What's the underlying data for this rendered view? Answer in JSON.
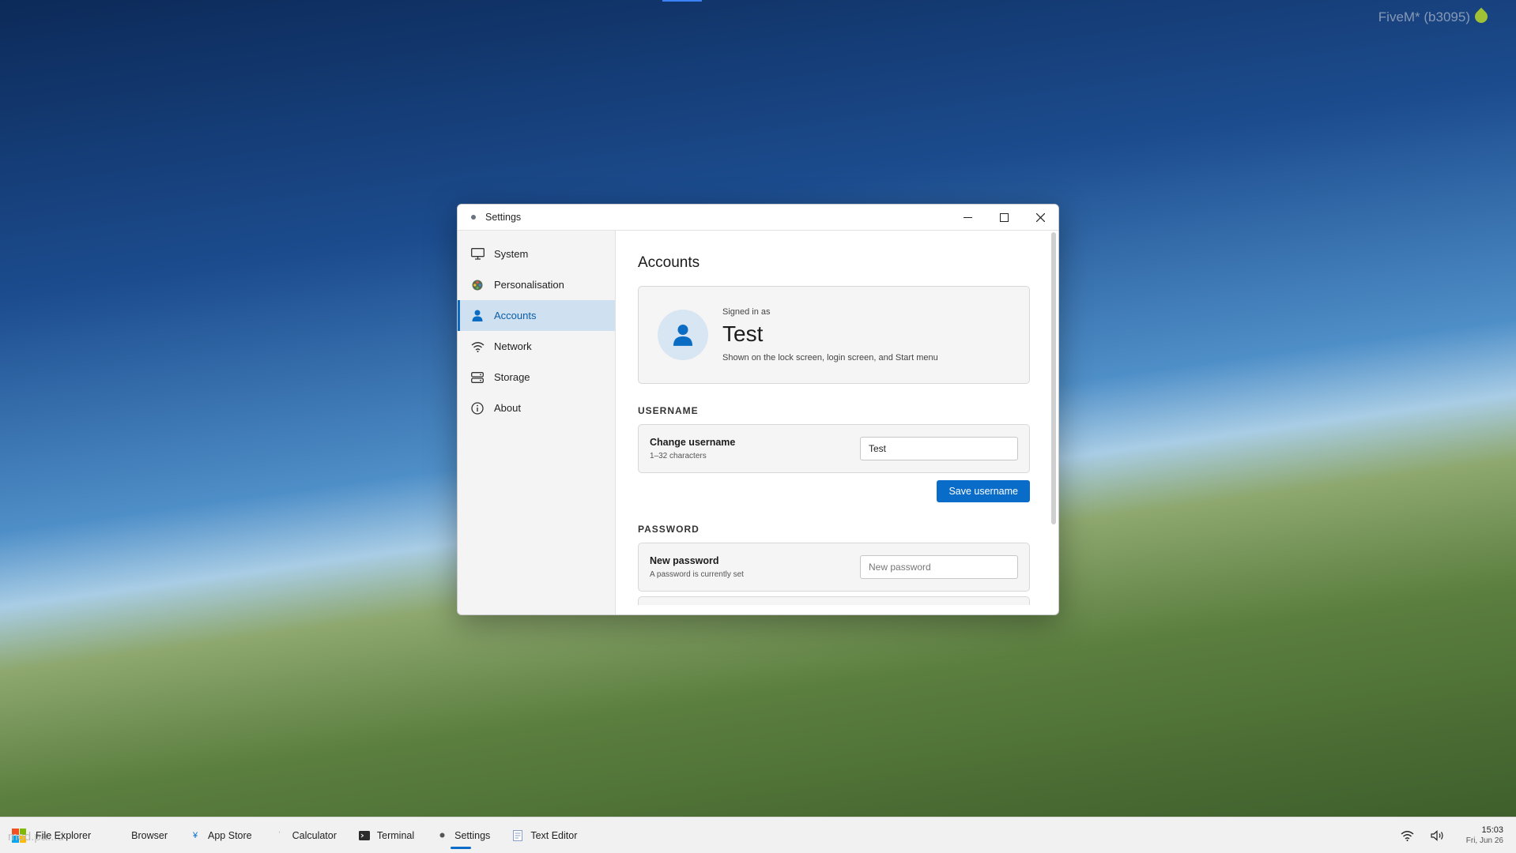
{
  "overlay": {
    "watermark": "FiveM* (b3095)"
  },
  "window": {
    "title": "Settings",
    "controls": {
      "minimize": "─",
      "maximize": "☐",
      "close": "✕"
    }
  },
  "sidebar": {
    "items": [
      {
        "label": "System",
        "icon": "monitor-icon"
      },
      {
        "label": "Personalisation",
        "icon": "palette-icon"
      },
      {
        "label": "Accounts",
        "icon": "person-icon",
        "active": true
      },
      {
        "label": "Network",
        "icon": "wifi-icon"
      },
      {
        "label": "Storage",
        "icon": "storage-icon"
      },
      {
        "label": "About",
        "icon": "info-icon"
      }
    ]
  },
  "main": {
    "title": "Accounts",
    "profile": {
      "signed_in_label": "Signed in as",
      "name": "Test",
      "description": "Shown on the lock screen, login screen, and Start menu"
    },
    "username_section": {
      "heading": "USERNAME",
      "label": "Change username",
      "hint": "1–32 characters",
      "value": "Test",
      "save_button": "Save username"
    },
    "password_section": {
      "heading": "PASSWORD",
      "label": "New password",
      "hint": "A password is currently set",
      "placeholder": "New password"
    }
  },
  "taskbar": {
    "ghost_text": "mod.pa...d",
    "apps": [
      {
        "label": "File Explorer"
      },
      {
        "label": "Browser"
      },
      {
        "label": "App Store"
      },
      {
        "label": "Calculator"
      },
      {
        "label": "Terminal"
      },
      {
        "label": "Settings",
        "active": true
      },
      {
        "label": "Text Editor"
      }
    ],
    "clock": {
      "time": "15:03",
      "date": "Fri, Jun 26"
    }
  },
  "colors": {
    "accent": "#0a6cc9",
    "active_nav_bg": "#cfe0f0"
  }
}
